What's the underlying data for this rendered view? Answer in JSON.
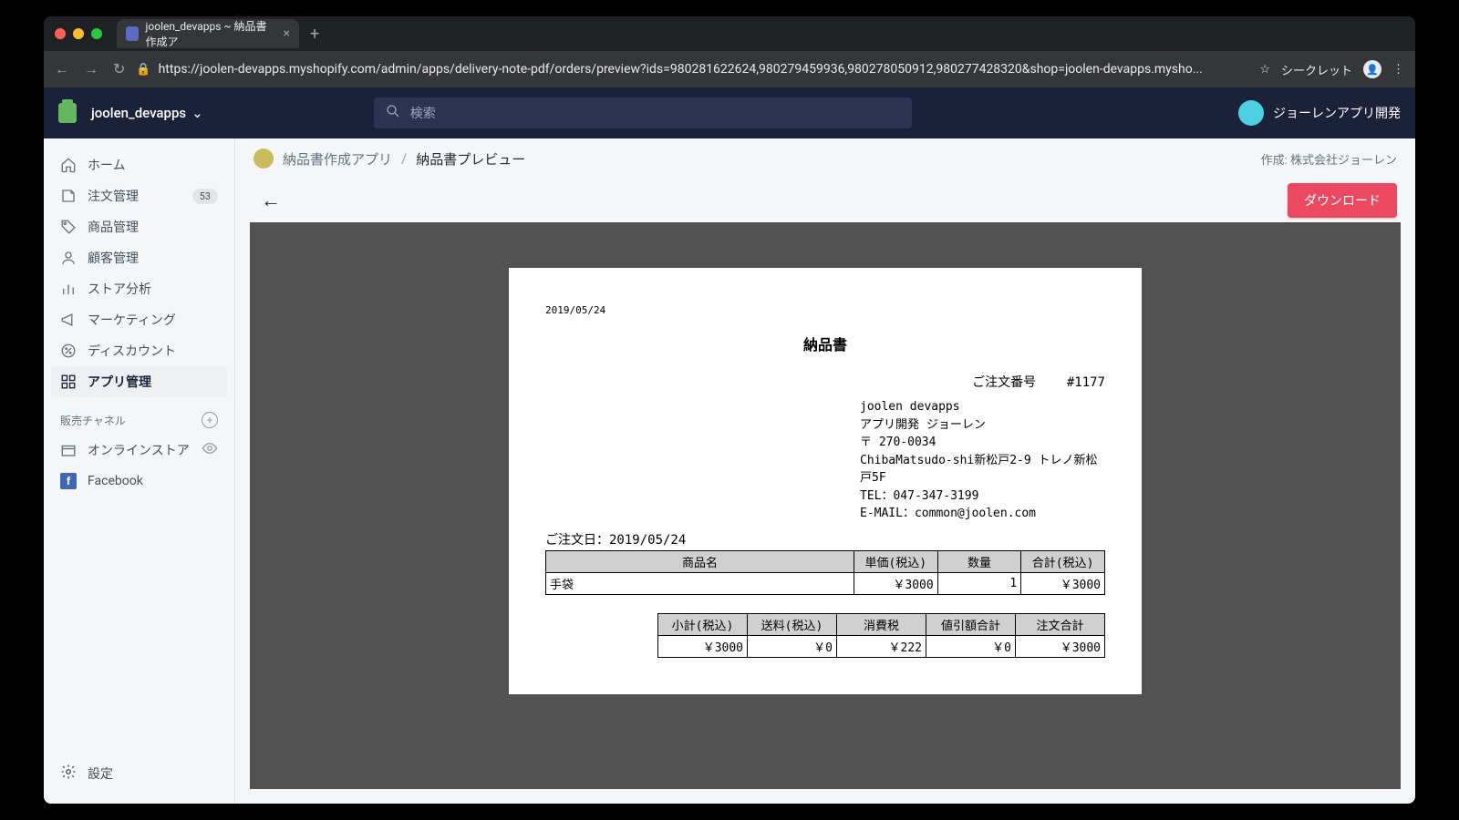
{
  "browser": {
    "tab_title": "joolen_devapps ~ 納品書作成ア",
    "url": "https://joolen-devapps.myshopify.com/admin/apps/delivery-note-pdf/orders/preview?ids=980281622624,980279459936,980278050912,980277428320&shop=joolen-devapps.mysho...",
    "mode_label": "シークレット"
  },
  "topbar": {
    "shop_name": "joolen_devapps",
    "search_placeholder": "検索",
    "user_name": "ジョーレンアプリ開発"
  },
  "sidebar": {
    "items": [
      {
        "label": "ホーム"
      },
      {
        "label": "注文管理",
        "badge": "53"
      },
      {
        "label": "商品管理"
      },
      {
        "label": "顧客管理"
      },
      {
        "label": "ストア分析"
      },
      {
        "label": "マーケティング"
      },
      {
        "label": "ディスカウント"
      },
      {
        "label": "アプリ管理"
      }
    ],
    "channels_label": "販売チャネル",
    "channels": [
      {
        "label": "オンラインストア"
      },
      {
        "label": "Facebook"
      }
    ],
    "settings_label": "設定"
  },
  "breadcrumb": {
    "app_name": "納品書作成アプリ",
    "page": "納品書プレビュー",
    "credit": "作成: 株式会社ジョーレン"
  },
  "toolbar": {
    "download_label": "ダウンロード"
  },
  "doc": {
    "print_date": "2019/05/24",
    "title": "納品書",
    "order_number_label": "ご注文番号",
    "order_number": "#1177",
    "company": {
      "name1": "joolen devapps",
      "name2": "アプリ開発 ジョーレン",
      "postal": "〒 270-0034",
      "address": "ChibaMatsudo-shi新松戸2-9 トレノ新松戸5F",
      "tel": "TEL：047-347-3199",
      "email": "E-MAIL：common@joolen.com"
    },
    "order_date_label": "ご注文日：",
    "order_date": "2019/05/24",
    "items_header": {
      "name": "商品名",
      "unit_price": "単価(税込)",
      "qty": "数量",
      "total": "合計(税込)"
    },
    "items": [
      {
        "name": "手袋",
        "unit_price": "￥3000",
        "qty": "1",
        "total": "￥3000"
      }
    ],
    "summary_header": {
      "subtotal": "小計(税込)",
      "shipping": "送料(税込)",
      "tax": "消費税",
      "discount": "値引額合計",
      "order_total": "注文合計"
    },
    "summary": {
      "subtotal": "￥3000",
      "shipping": "￥0",
      "tax": "￥222",
      "discount": "￥0",
      "order_total": "￥3000"
    }
  }
}
